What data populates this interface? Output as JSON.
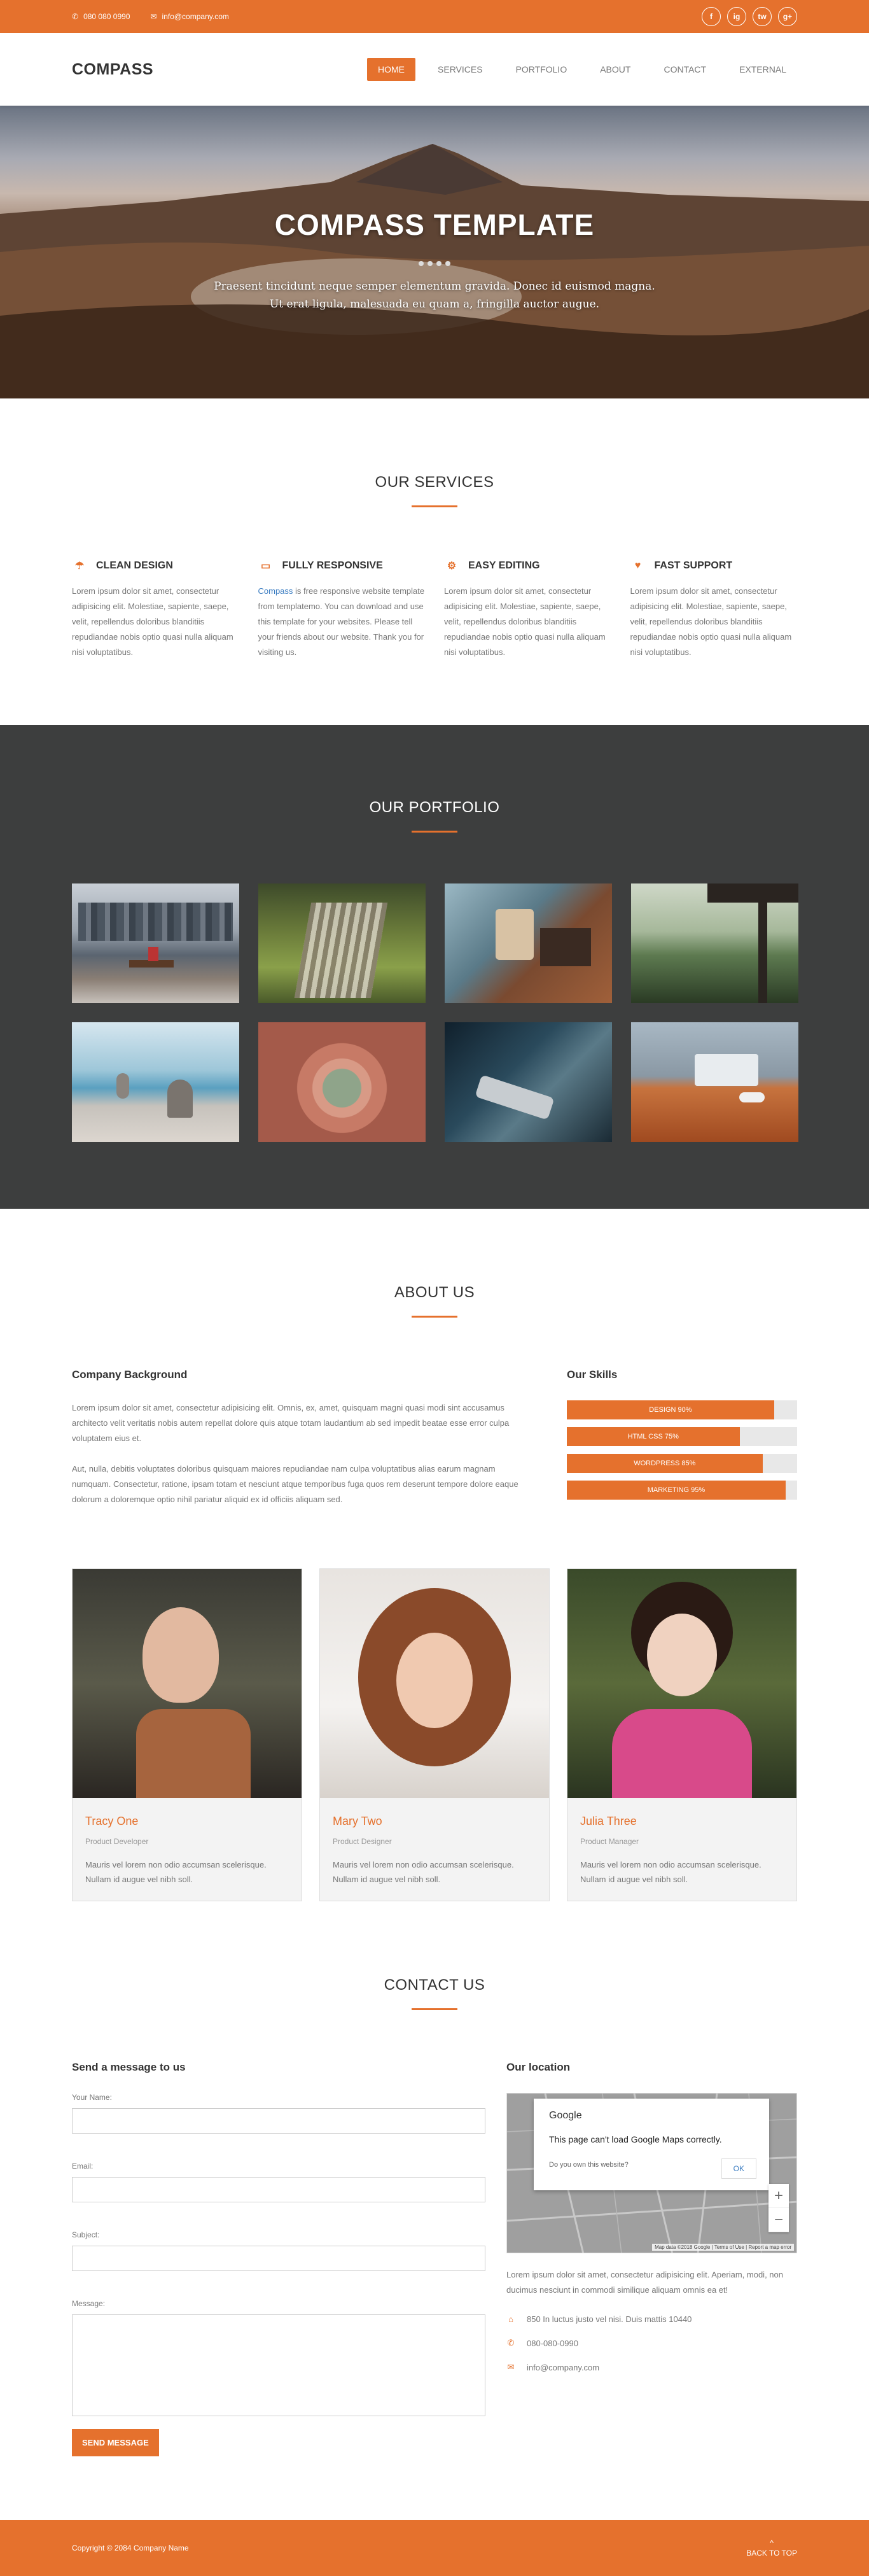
{
  "topbar": {
    "phone": "080 080 0990",
    "email": "info@company.com",
    "social": [
      "f",
      "ig",
      "tw",
      "g+"
    ]
  },
  "header": {
    "logo": "COMPASS",
    "nav": [
      "HOME",
      "SERVICES",
      "PORTFOLIO",
      "ABOUT",
      "CONTACT",
      "EXTERNAL"
    ],
    "active": "HOME"
  },
  "hero": {
    "title": "COMPASS TEMPLATE",
    "line1": "Praesent tincidunt neque semper elementum gravida. Donec id euismod magna.",
    "line2": "Ut erat ligula, malesuada eu quam a, fringilla auctor augue."
  },
  "services": {
    "title": "OUR SERVICES",
    "items": [
      {
        "icon": "umbrella-icon",
        "title": "CLEAN DESIGN",
        "text": "Lorem ipsum dolor sit amet, consectetur adipisicing elit. Molestiae, sapiente, saepe, velit, repellendus doloribus blanditiis repudiandae nobis optio quasi nulla aliquam nisi voluptatibus."
      },
      {
        "icon": "monitor-icon",
        "title": "FULLY RESPONSIVE",
        "link": "Compass",
        "text": "is free responsive website template from templatemo. You can download and use this template for your websites. Please tell your friends about our website. Thank you for visiting us."
      },
      {
        "icon": "gears-icon",
        "title": "EASY EDITING",
        "text": "Lorem ipsum dolor sit amet, consectetur adipisicing elit. Molestiae, sapiente, saepe, velit, repellendus doloribus blanditiis repudiandae nobis optio quasi nulla aliquam nisi voluptatibus."
      },
      {
        "icon": "heart-icon",
        "title": "FAST SUPPORT",
        "text": "Lorem ipsum dolor sit amet, consectetur adipisicing elit. Molestiae, sapiente, saepe, velit, repellendus doloribus blanditiis repudiandae nobis optio quasi nulla aliquam nisi voluptatibus."
      }
    ]
  },
  "portfolio": {
    "title": "OUR PORTFOLIO"
  },
  "about": {
    "title": "ABOUT US",
    "background_title": "Company Background",
    "para1": "Lorem ipsum dolor sit amet, consectetur adipisicing elit. Omnis, ex, amet, quisquam magni quasi modi sint accusamus architecto velit veritatis nobis autem repellat dolore quis atque totam laudantium ab sed impedit beatae esse error culpa voluptatem eius et.",
    "para2": "Aut, nulla, debitis voluptates doloribus quisquam maiores repudiandae nam culpa voluptatibus alias earum magnam numquam. Consectetur, ratione, ipsam totam et nesciunt atque temporibus fuga quos rem deserunt tempore dolore eaque dolorum a doloremque optio nihil pariatur aliquid ex id officiis aliquam sed.",
    "skills_title": "Our Skills",
    "skills": [
      {
        "label": "DESIGN 90%",
        "value": 90
      },
      {
        "label": "HTML CSS 75%",
        "value": 75
      },
      {
        "label": "WORDPRESS 85%",
        "value": 85
      },
      {
        "label": "MARKETING 95%",
        "value": 95
      }
    ],
    "team": [
      {
        "name": "Tracy One",
        "role": "Product Developer",
        "desc": "Mauris vel lorem non odio accumsan scelerisque. Nullam id augue vel nibh soll."
      },
      {
        "name": "Mary Two",
        "role": "Product Designer",
        "desc": "Mauris vel lorem non odio accumsan scelerisque. Nullam id augue vel nibh soll."
      },
      {
        "name": "Julia Three",
        "role": "Product Manager",
        "desc": "Mauris vel lorem non odio accumsan scelerisque. Nullam id augue vel nibh soll."
      }
    ]
  },
  "contact": {
    "title": "CONTACT US",
    "form_title": "Send a message to us",
    "name_label": "Your Name:",
    "email_label": "Email:",
    "subject_label": "Subject:",
    "message_label": "Message:",
    "send": "SEND MESSAGE",
    "location_title": "Our location",
    "map": {
      "brand": "Google",
      "error": "This page can't load Google Maps correctly.",
      "question": "Do you own this website?",
      "ok": "OK",
      "footer": "Map data ©2018 Google  |  Terms of Use  |  Report a map error"
    },
    "location_text": "Lorem ipsum dolor sit amet, consectetur adipisicing elit. Aperiam, modi, non ducimus nesciunt in commodi similique aliquam omnis ea et!",
    "address": "850 In luctus justo vel nisi. Duis mattis 10440",
    "phone": "080-080-0990",
    "email": "info@company.com"
  },
  "footer": {
    "copyright": "Copyright © 2084 Company Name",
    "back": "BACK TO TOP"
  }
}
